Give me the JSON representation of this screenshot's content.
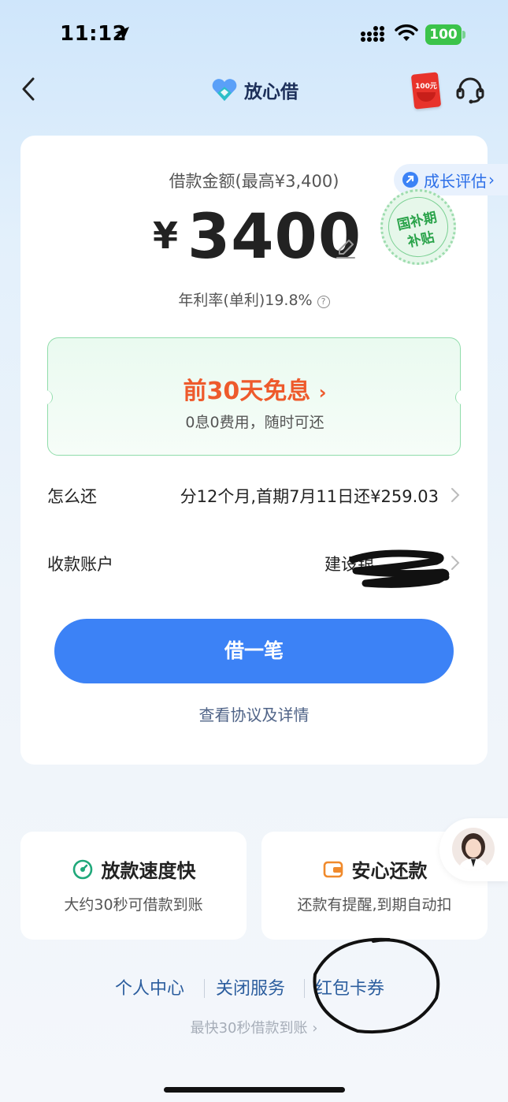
{
  "status_bar": {
    "time": "11:12",
    "battery": "100"
  },
  "nav": {
    "brand": "放心借",
    "red_packet_text": "100元"
  },
  "loan": {
    "limit_title": "借款金额(最高¥3,400)",
    "growth_label": "成长评估",
    "currency": "¥",
    "amount": "3400",
    "rate": "年利率(单利)19.8%"
  },
  "promo": {
    "title": "前30天免息",
    "subtitle": "0息0费用，随时可还",
    "seal_line1": "国补期",
    "seal_line2": "补贴"
  },
  "repay": {
    "label": "怎么还",
    "value": "分12个月,首期7月11日还¥259.03"
  },
  "account": {
    "label": "收款账户",
    "value": "建设银"
  },
  "borrow_button": "借一笔",
  "agreement_link": "查看协议及详情",
  "features": [
    {
      "title": "放款速度快",
      "desc": "大约30秒可借款到账"
    },
    {
      "title": "安心还款",
      "desc": "还款有提醒,到期自动扣"
    }
  ],
  "footer": {
    "links": [
      "个人中心",
      "关闭服务",
      "红包卡券"
    ],
    "note": "最快30秒借款到账"
  },
  "colors": {
    "primary": "#3c82f6",
    "promo_orange": "#ee5a2c",
    "promo_green_border": "#8fdcaa",
    "battery_green": "#3bc34a"
  }
}
